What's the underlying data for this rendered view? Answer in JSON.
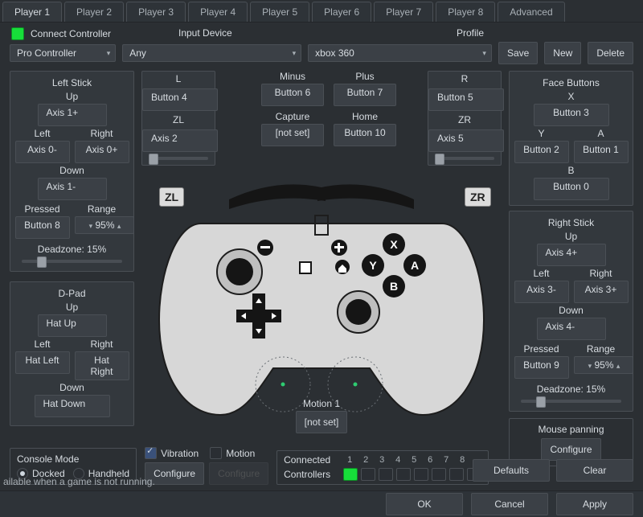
{
  "tabs": [
    "Player 1",
    "Player 2",
    "Player 3",
    "Player 4",
    "Player 5",
    "Player 6",
    "Player 7",
    "Player 8",
    "Advanced"
  ],
  "active_tab_index": 0,
  "topbar": {
    "connect_label": "Connect Controller",
    "input_device_label": "Input Device",
    "profile_label": "Profile",
    "controller_type": "Pro Controller",
    "input_device_value": "Any",
    "profile_value": "xbox 360",
    "save": "Save",
    "new": "New",
    "delete": "Delete"
  },
  "left_stick": {
    "title": "Left Stick",
    "up_label": "Up",
    "up": "Axis 1+",
    "left_label": "Left",
    "left": "Axis 0-",
    "right_label": "Right",
    "right": "Axis 0+",
    "down_label": "Down",
    "down": "Axis 1-",
    "pressed_label": "Pressed",
    "pressed": "Button 8",
    "range_label": "Range",
    "range": "95%",
    "deadzone_label": "Deadzone: 15%"
  },
  "dpad": {
    "title": "D-Pad",
    "up_label": "Up",
    "up": "Hat Up",
    "left_label": "Left",
    "left": "Hat Left",
    "right_label": "Right",
    "right": "Hat Right",
    "down_label": "Down",
    "down": "Hat Down"
  },
  "right_stick": {
    "title": "Right Stick",
    "up_label": "Up",
    "up": "Axis 4+",
    "left_label": "Left",
    "left": "Axis 3-",
    "right_label": "Right",
    "right": "Axis 3+",
    "down_label": "Down",
    "down": "Axis 4-",
    "pressed_label": "Pressed",
    "pressed": "Button 9",
    "range_label": "Range",
    "range": "95%",
    "deadzone_label": "Deadzone: 15%",
    "mouse_panning_label": "Mouse panning",
    "mouse_panning_btn": "Configure"
  },
  "triggers_left": {
    "L": "L",
    "L_btn": "Button 4",
    "ZL": "ZL",
    "ZL_btn": "Axis 2"
  },
  "triggers_right": {
    "R": "R",
    "R_btn": "Button 5",
    "ZR": "ZR",
    "ZR_btn": "Axis 5"
  },
  "middle": {
    "minus_label": "Minus",
    "minus": "Button 6",
    "plus_label": "Plus",
    "plus": "Button 7",
    "capture_label": "Capture",
    "capture": "[not set]",
    "home_label": "Home",
    "home": "Button 10"
  },
  "face": {
    "title": "Face Buttons",
    "x_label": "X",
    "x": "Button 3",
    "y_label": "Y",
    "y": "Button 2",
    "a_label": "A",
    "a": "Button 1",
    "b_label": "B",
    "b": "Button 0"
  },
  "zlzr": {
    "zl": "ZL",
    "zr": "ZR"
  },
  "motion1": {
    "title": "Motion 1",
    "value": "[not set]"
  },
  "console": {
    "title": "Console Mode",
    "docked": "Docked",
    "handheld": "Handheld",
    "docked_selected": true
  },
  "checks": {
    "vibration": "Vibration",
    "motion": "Motion",
    "configure": "Configure",
    "configure_disabled": "Configure"
  },
  "controllers": {
    "connected": "Connected",
    "label": "Controllers",
    "nums": [
      "1",
      "2",
      "3",
      "4",
      "5",
      "6",
      "7",
      "8"
    ]
  },
  "defaults": "Defaults",
  "clear": "Clear",
  "footer": {
    "ok": "OK",
    "cancel": "Cancel",
    "apply": "Apply"
  },
  "status": "ailable when a game is not running."
}
